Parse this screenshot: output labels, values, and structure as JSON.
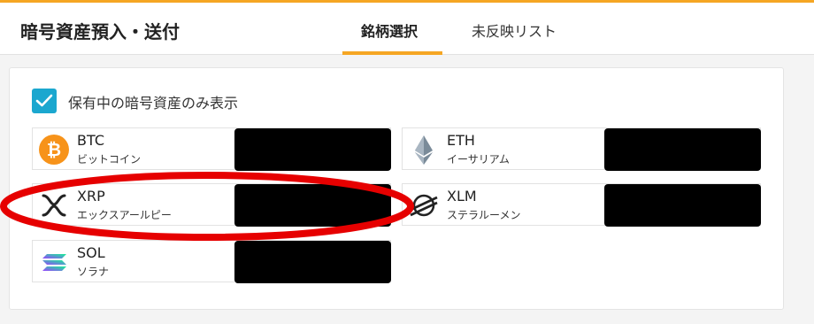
{
  "header": {
    "title": "暗号資産預入・送付",
    "tabs": [
      {
        "label": "銘柄選択",
        "active": true
      },
      {
        "label": "未反映リスト",
        "active": false
      }
    ]
  },
  "filter": {
    "checkbox_label": "保有中の暗号資産のみ表示",
    "checked": true
  },
  "coins": [
    {
      "symbol": "BTC",
      "name": "ビットコイン",
      "icon": "bitcoin-icon"
    },
    {
      "symbol": "ETH",
      "name": "イーサリアム",
      "icon": "ethereum-icon"
    },
    {
      "symbol": "XRP",
      "name": "エックスアールピー",
      "icon": "xrp-icon"
    },
    {
      "symbol": "XLM",
      "name": "ステラルーメン",
      "icon": "stellar-icon"
    },
    {
      "symbol": "SOL",
      "name": "ソラナ",
      "icon": "solana-icon"
    }
  ],
  "colors": {
    "accent": "#f5a623",
    "checkbox": "#1ba7cf",
    "annotation": "#e60000",
    "bitcoin": "#f7931a"
  }
}
